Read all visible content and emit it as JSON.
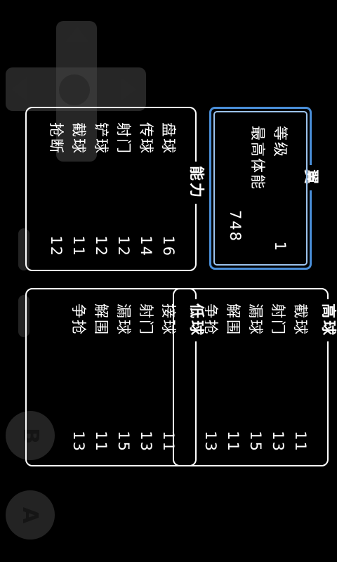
{
  "player": {
    "name": "翼"
  },
  "level": {
    "label": "等级",
    "value": "1"
  },
  "max_stamina": {
    "label": "最高体能",
    "value": "748"
  },
  "ability": {
    "title": "能力",
    "rows": [
      {
        "label": "盘球",
        "value": "16"
      },
      {
        "label": "传球",
        "value": "14"
      },
      {
        "label": "射门",
        "value": "12"
      },
      {
        "label": "铲球",
        "value": "12"
      },
      {
        "label": "截球",
        "value": "11"
      },
      {
        "label": "抢断",
        "value": "12"
      }
    ]
  },
  "high_ball": {
    "title": "高球",
    "rows": [
      {
        "label": "截球",
        "value": "11"
      },
      {
        "label": "射门",
        "value": "13"
      },
      {
        "label": "漏球",
        "value": "15"
      },
      {
        "label": "解围",
        "value": "11"
      },
      {
        "label": "争抢",
        "value": "13"
      }
    ]
  },
  "low_ball": {
    "title": "低球",
    "rows": [
      {
        "label": "接球",
        "value": "11"
      },
      {
        "label": "射门",
        "value": "13"
      },
      {
        "label": "漏球",
        "value": "15"
      },
      {
        "label": "解围",
        "value": "11"
      },
      {
        "label": "争抢",
        "value": "13"
      }
    ]
  },
  "controls": {
    "a_label": "A",
    "b_label": "B"
  }
}
